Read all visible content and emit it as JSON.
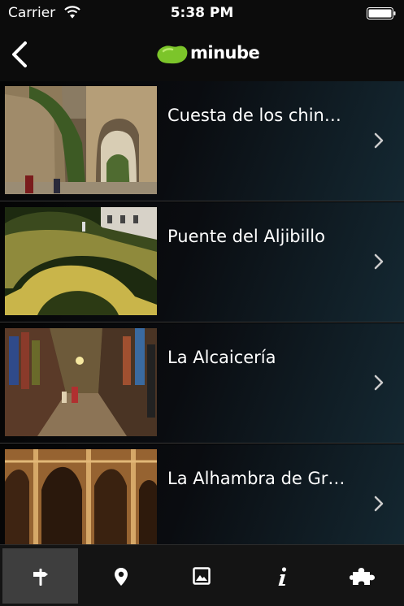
{
  "status_bar": {
    "carrier": "Carrier",
    "time": "5:38 PM",
    "icons": [
      "wifi-icon",
      "battery-icon"
    ]
  },
  "nav_bar": {
    "back_icon": "chevron-left-icon",
    "logo_text": "minube",
    "logo_color": "#7cc52a"
  },
  "places": [
    {
      "title": "Cuesta de los chin…",
      "image": "arched stone street with trees"
    },
    {
      "title": "Puente del Aljibillo",
      "image": "illuminated stone bridge at night"
    },
    {
      "title": "La Alcaicería",
      "image": "narrow market street with shops"
    },
    {
      "title": "La Alhambra de Gr…",
      "image": "ornate moorish arches"
    }
  ],
  "row_chevron_icon": "chevron-right-icon",
  "tab_bar": {
    "tabs": [
      {
        "icon": "signpost-icon",
        "active": true
      },
      {
        "icon": "map-pin-icon",
        "active": false
      },
      {
        "icon": "photo-icon",
        "active": false
      },
      {
        "icon": "info-icon",
        "active": false
      },
      {
        "icon": "puzzle-icon",
        "active": false
      }
    ]
  }
}
